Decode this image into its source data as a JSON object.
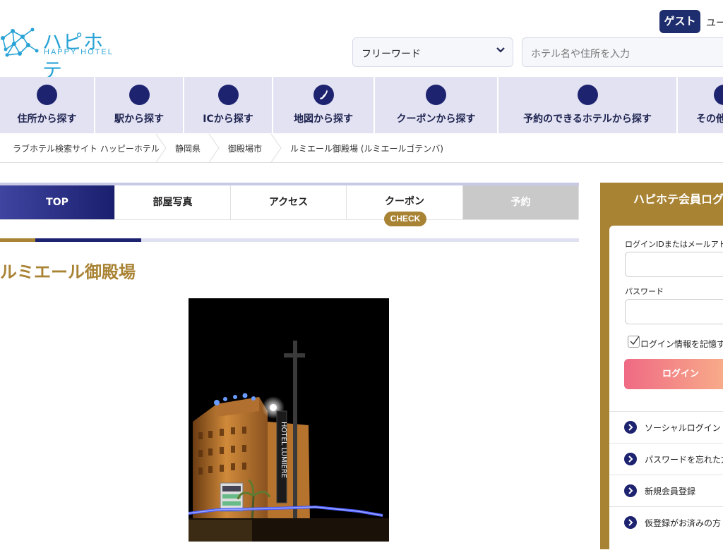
{
  "header": {
    "logo_text": "ハピホテ",
    "logo_sub": "HAPPY HOTEL",
    "guest_label": "ゲスト",
    "user_label": "ユー",
    "search_select_value": "フリーワード",
    "search_placeholder": "ホテル名や住所を入力"
  },
  "nav": {
    "items": [
      {
        "label": "住所から探す"
      },
      {
        "label": "駅から探す"
      },
      {
        "label": "ICから探す"
      },
      {
        "label": "地図から探す"
      },
      {
        "label": "クーポンから探す"
      },
      {
        "label": "予約のできるホテルから探す"
      },
      {
        "label": "その他"
      }
    ]
  },
  "breadcrumb": [
    "ラブホテル検索サイト ハッピーホテル",
    "静岡県",
    "御殿場市",
    "ルミエール御殿場 (ルミエールゴテンバ)"
  ],
  "tabs": {
    "top": "TOP",
    "photos": "部屋写真",
    "access": "アクセス",
    "coupon": "クーポン",
    "coupon_badge": "CHECK",
    "reserve": "予約"
  },
  "hotel": {
    "name": "ルミエール御殿場",
    "sign_text": "HOTEL LUMIERE"
  },
  "login": {
    "title": "ハピホテ会員ログ",
    "id_label": "ログインIDまたはメールアドレ",
    "password_label": "パスワード",
    "remember_label": "ログイン情報を記憶す",
    "login_button": "ログイン",
    "links": [
      "ソーシャルログイン",
      "パスワードを忘れた方",
      "新規会員登録",
      "仮登録がお済みの方"
    ]
  },
  "colors": {
    "navy": "#1e2370",
    "gold": "#a98334",
    "nav_bg": "#e2e2f2",
    "logo_blue": "#29a3d6"
  }
}
